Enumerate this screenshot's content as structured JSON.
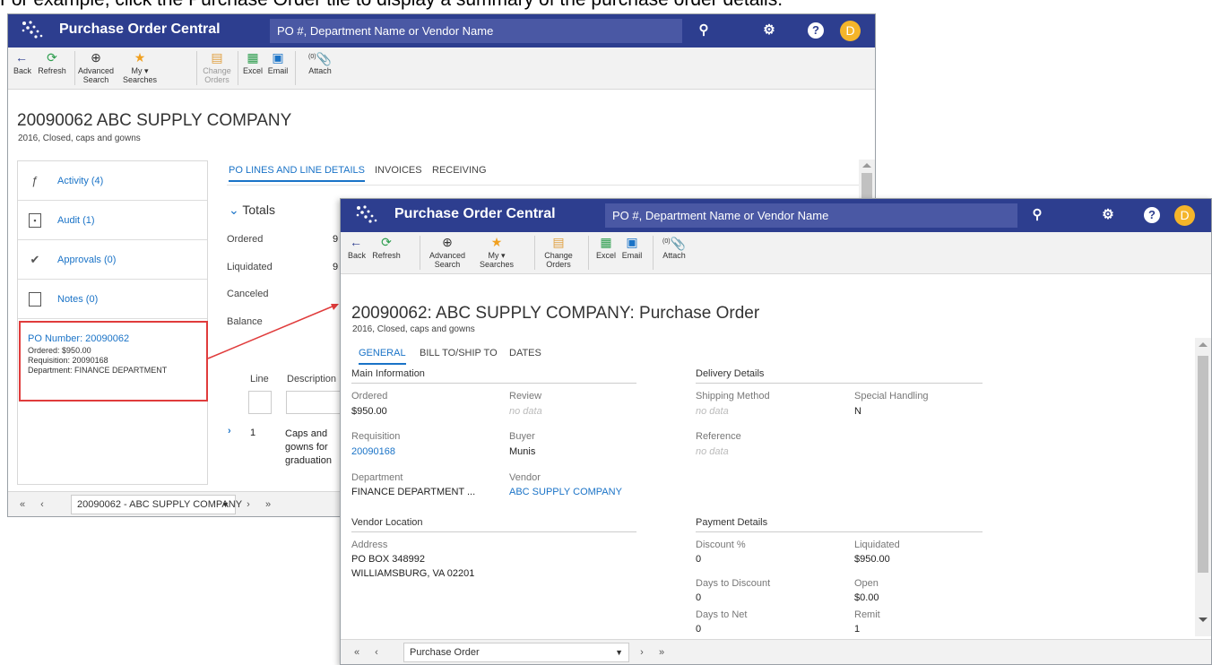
{
  "caption": "For example, click the Purchase Order tile to display a summary of the purchase order details.",
  "app": {
    "title": "Purchase Order Central",
    "search_placeholder": "PO #, Department Name or Vendor Name",
    "avatar_initial": "D"
  },
  "toolbar": {
    "back": "Back",
    "refresh": "Refresh",
    "advanced_search_1": "Advanced",
    "advanced_search_2": "Search",
    "my_searches_1": "My",
    "my_searches_2": "Searches",
    "change_orders_1": "Change",
    "change_orders_2": "Orders",
    "excel": "Excel",
    "email": "Email",
    "attach_count": "(0)",
    "attach": "Attach"
  },
  "back_window": {
    "title": "20090062  ABC SUPPLY COMPANY",
    "subtitle": "2016, Closed, caps and gowns",
    "sidebar": [
      {
        "label": "Activity (4)",
        "icon": "bolt-icon"
      },
      {
        "label": "Audit (1)",
        "icon": "audit-doc-icon"
      },
      {
        "label": "Approvals (0)",
        "icon": "check-circle-icon"
      },
      {
        "label": "Notes (0)",
        "icon": "note-icon"
      }
    ],
    "po_tile": {
      "number_label": "PO Number: 20090062",
      "ordered_label": "Ordered:",
      "ordered_value": "$950.00",
      "requisition_label": "Requisition:",
      "requisition_value": "20090168",
      "department_label": "Department:",
      "department_value": "FINANCE DEPARTMENT"
    },
    "tabs": [
      "PO LINES AND LINE DETAILS",
      "INVOICES",
      "RECEIVING"
    ],
    "totals": {
      "heading": "Totals",
      "rows": [
        "Ordered",
        "Liquidated",
        "Canceled",
        "Balance"
      ],
      "partial_values": [
        "9",
        "9"
      ]
    },
    "lines": {
      "col_line": "Line",
      "col_description": "Description",
      "line_number": "1",
      "description": "Caps and gowns for graduation"
    },
    "pager": {
      "selected": "20090062 - ABC SUPPLY COMPANY"
    }
  },
  "front_window": {
    "title": "20090062: ABC SUPPLY COMPANY: Purchase Order",
    "subtitle": "2016, Closed, caps and gowns",
    "tabs": [
      "GENERAL",
      "BILL TO/SHIP TO",
      "DATES"
    ],
    "main_info": {
      "heading": "Main Information",
      "ordered_label": "Ordered",
      "ordered_value": "$950.00",
      "review_label": "Review",
      "review_value": "no data",
      "requisition_label": "Requisition",
      "requisition_value": "20090168",
      "buyer_label": "Buyer",
      "buyer_value": "Munis",
      "department_label": "Department",
      "department_value": "FINANCE DEPARTMENT ...",
      "vendor_label": "Vendor",
      "vendor_value": "ABC SUPPLY COMPANY"
    },
    "delivery": {
      "heading": "Delivery Details",
      "shipping_label": "Shipping Method",
      "shipping_value": "no data",
      "special_label": "Special Handling",
      "special_value": "N",
      "reference_label": "Reference",
      "reference_value": "no data"
    },
    "vendor_location": {
      "heading": "Vendor Location",
      "address_label": "Address",
      "address_line1": "PO BOX 348992",
      "address_line2": "WILLIAMSBURG, VA 02201"
    },
    "payment": {
      "heading": "Payment Details",
      "discount_label": "Discount %",
      "discount_value": "0",
      "liquidated_label": "Liquidated",
      "liquidated_value": "$950.00",
      "days_discount_label": "Days to Discount",
      "days_discount_value": "0",
      "open_label": "Open",
      "open_value": "$0.00",
      "days_net_label": "Days to Net",
      "days_net_value": "0",
      "remit_label": "Remit",
      "remit_value": "1"
    },
    "pager": {
      "selected": "Purchase Order"
    }
  },
  "colors": {
    "nav": "#2d3e8f",
    "accent": "#1a73c7",
    "highlight": "#e03c3c",
    "avatar": "#f5b52a"
  }
}
